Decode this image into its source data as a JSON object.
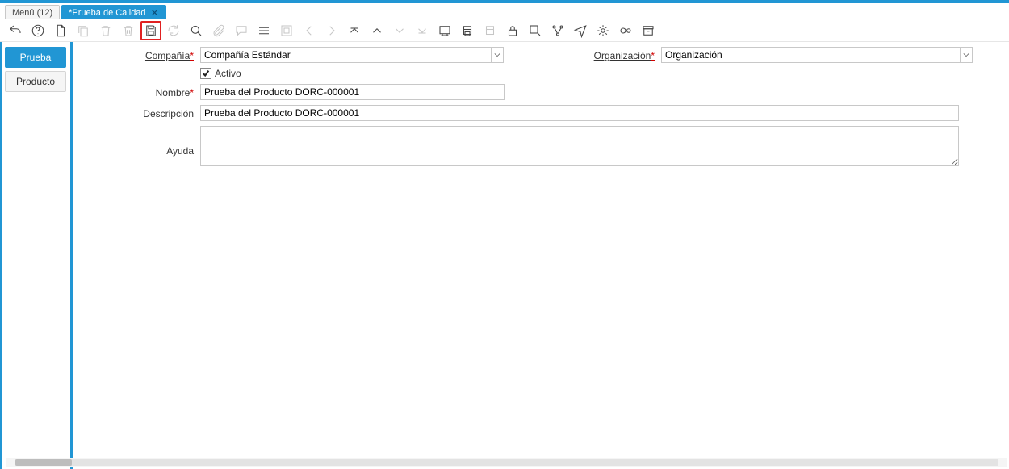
{
  "tabs": {
    "menu": {
      "label": "Menú (12)"
    },
    "active": {
      "label": "*Prueba de Calidad"
    }
  },
  "sidebar": {
    "items": [
      {
        "label": "Prueba"
      },
      {
        "label": "Producto"
      }
    ]
  },
  "toolbar": {
    "icons": [
      "undo-icon",
      "help-icon",
      "new-icon",
      "copy-icon",
      "delete-icon",
      "delete-all-icon",
      "save-icon",
      "refresh-icon",
      "search-icon",
      "attach-icon",
      "chat-icon",
      "grid-icon",
      "parent-icon",
      "prev-icon",
      "next-icon",
      "first-icon",
      "up-icon",
      "down-icon",
      "last-icon",
      "report-icon",
      "print-icon",
      "print-preview-icon",
      "lock-icon",
      "zoom-icon",
      "workflow-icon",
      "send-icon",
      "gear-icon",
      "process-icon",
      "archive-icon"
    ]
  },
  "form": {
    "company": {
      "label": "Compañía",
      "value": "Compañía Estándar"
    },
    "organization": {
      "label": "Organización",
      "value": "Organización"
    },
    "active": {
      "label": "Activo",
      "checked": true
    },
    "name": {
      "label": "Nombre",
      "value": "Prueba del Producto DORC-000001"
    },
    "description": {
      "label": "Descripción",
      "value": "Prueba del Producto DORC-000001"
    },
    "help": {
      "label": "Ayuda",
      "value": ""
    }
  }
}
